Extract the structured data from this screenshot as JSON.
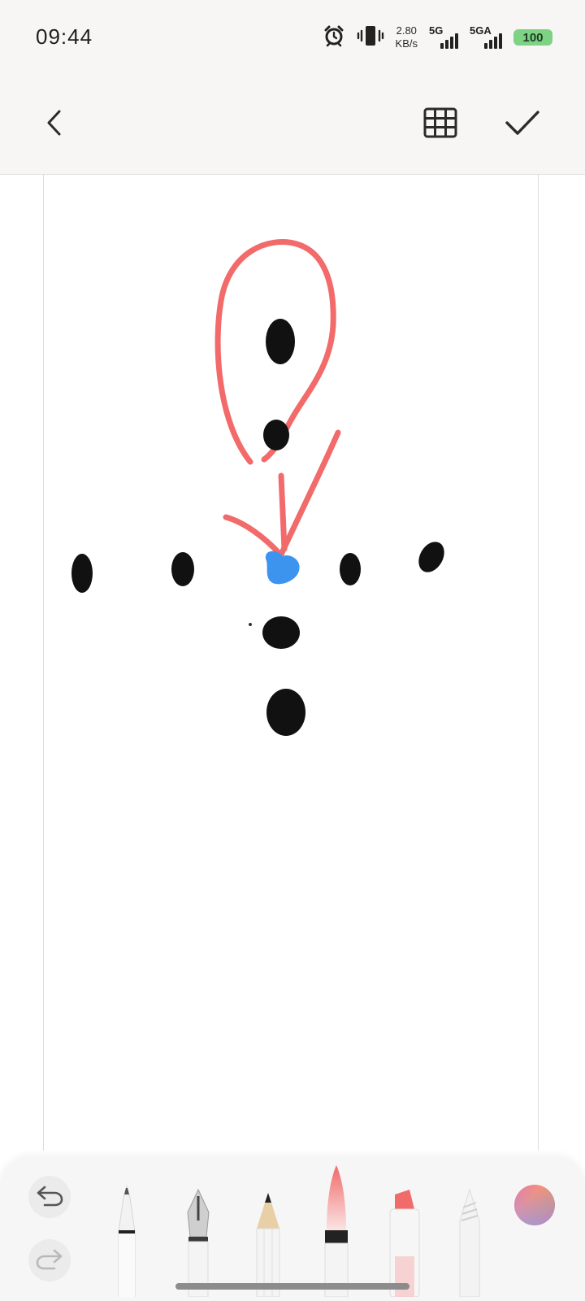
{
  "status_bar": {
    "time": "09:44",
    "net_speed_value": "2.80",
    "net_speed_unit": "KB/s",
    "sim1_label": "5G",
    "sim2_label": "5GA",
    "battery": "100",
    "icons": [
      "alarm-icon",
      "vibrate-icon"
    ]
  },
  "toolbar": {
    "back_icon": "chevron-left-icon",
    "grid_icon": "grid-icon",
    "done_icon": "checkmark-icon"
  },
  "tools": [
    {
      "name": "ballpoint-pen"
    },
    {
      "name": "fountain-pen"
    },
    {
      "name": "pencil"
    },
    {
      "name": "brush"
    },
    {
      "name": "highlighter",
      "color": "#f26b6b"
    },
    {
      "name": "eraser"
    }
  ],
  "colors": {
    "ink_black": "#111111",
    "ink_red": "#f26a6a",
    "ink_blue": "#3d94ee",
    "battery_green": "#7ed283"
  },
  "history": {
    "undo_icon": "undo-icon",
    "redo_icon": "redo-icon"
  },
  "color_picker_icon": "color-wheel-icon"
}
